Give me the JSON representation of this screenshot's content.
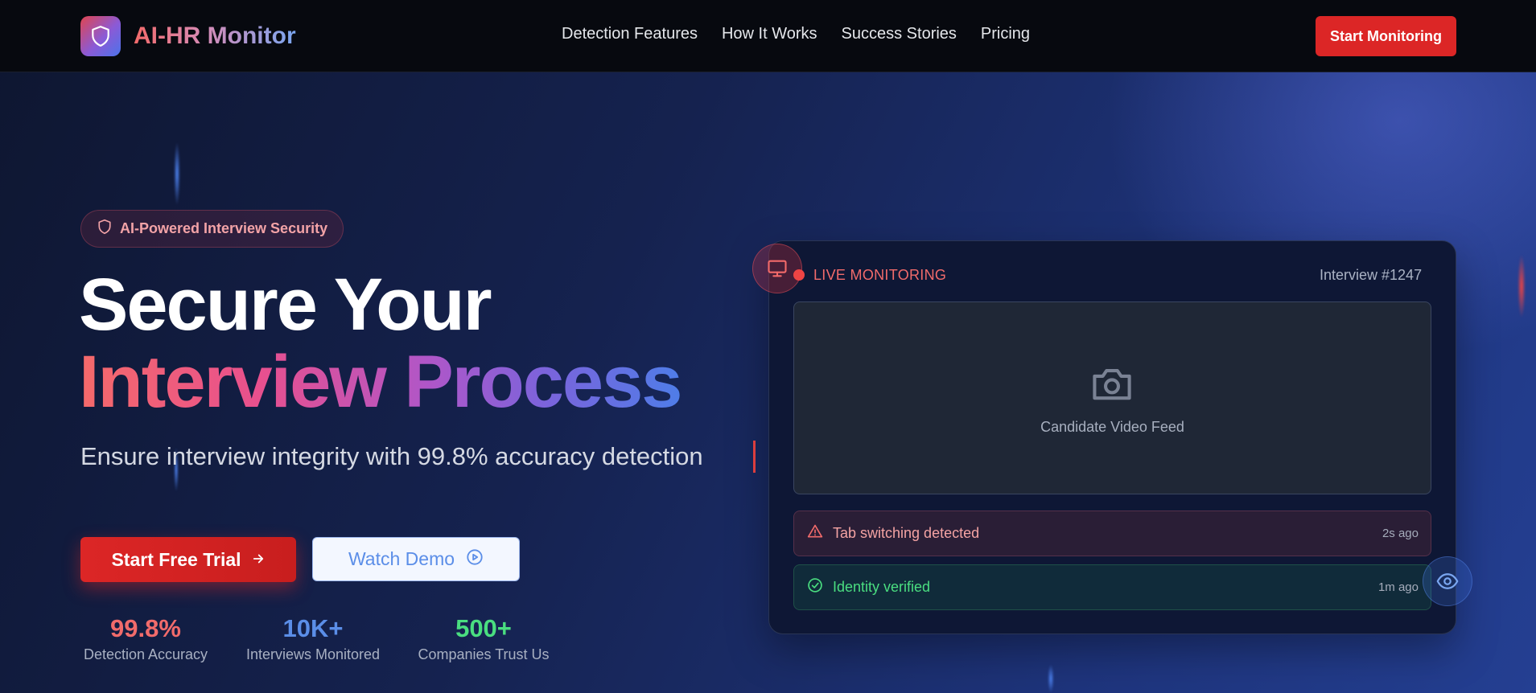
{
  "nav": {
    "brand": "AI-HR Monitor",
    "logo_icon": "shield-icon",
    "links": [
      "Detection Features",
      "How It Works",
      "Success Stories",
      "Pricing"
    ],
    "cta": "Start Monitoring"
  },
  "hero": {
    "badge": "AI-Powered Interview Security",
    "headline_line1": "Secure Your",
    "headline_line2": "Interview Process",
    "subtitle": "Ensure interview integrity with 99.8% accuracy detection",
    "primary_button": "Start Free Trial",
    "secondary_button": "Watch Demo",
    "stats": [
      {
        "value": "99.8%",
        "label": "Detection Accuracy",
        "color": "#f16b6b"
      },
      {
        "value": "10K+",
        "label": "Interviews Monitored",
        "color": "#5b8ee8"
      },
      {
        "value": "500+",
        "label": "Companies Trust Us",
        "color": "#4ade80"
      }
    ]
  },
  "monitor": {
    "status": "LIVE MONITORING",
    "interview_id": "Interview #1247",
    "video_label": "Candidate Video Feed",
    "alerts": [
      {
        "text": "Tab switching detected",
        "time": "2s ago",
        "icon": "warning-triangle-icon"
      },
      {
        "text": "Identity verified",
        "time": "1m ago",
        "icon": "check-circle-icon"
      }
    ]
  },
  "colors": {
    "accent_red": "#dc2626",
    "accent_blue": "#5b8ee8",
    "accent_green": "#4ade80"
  }
}
